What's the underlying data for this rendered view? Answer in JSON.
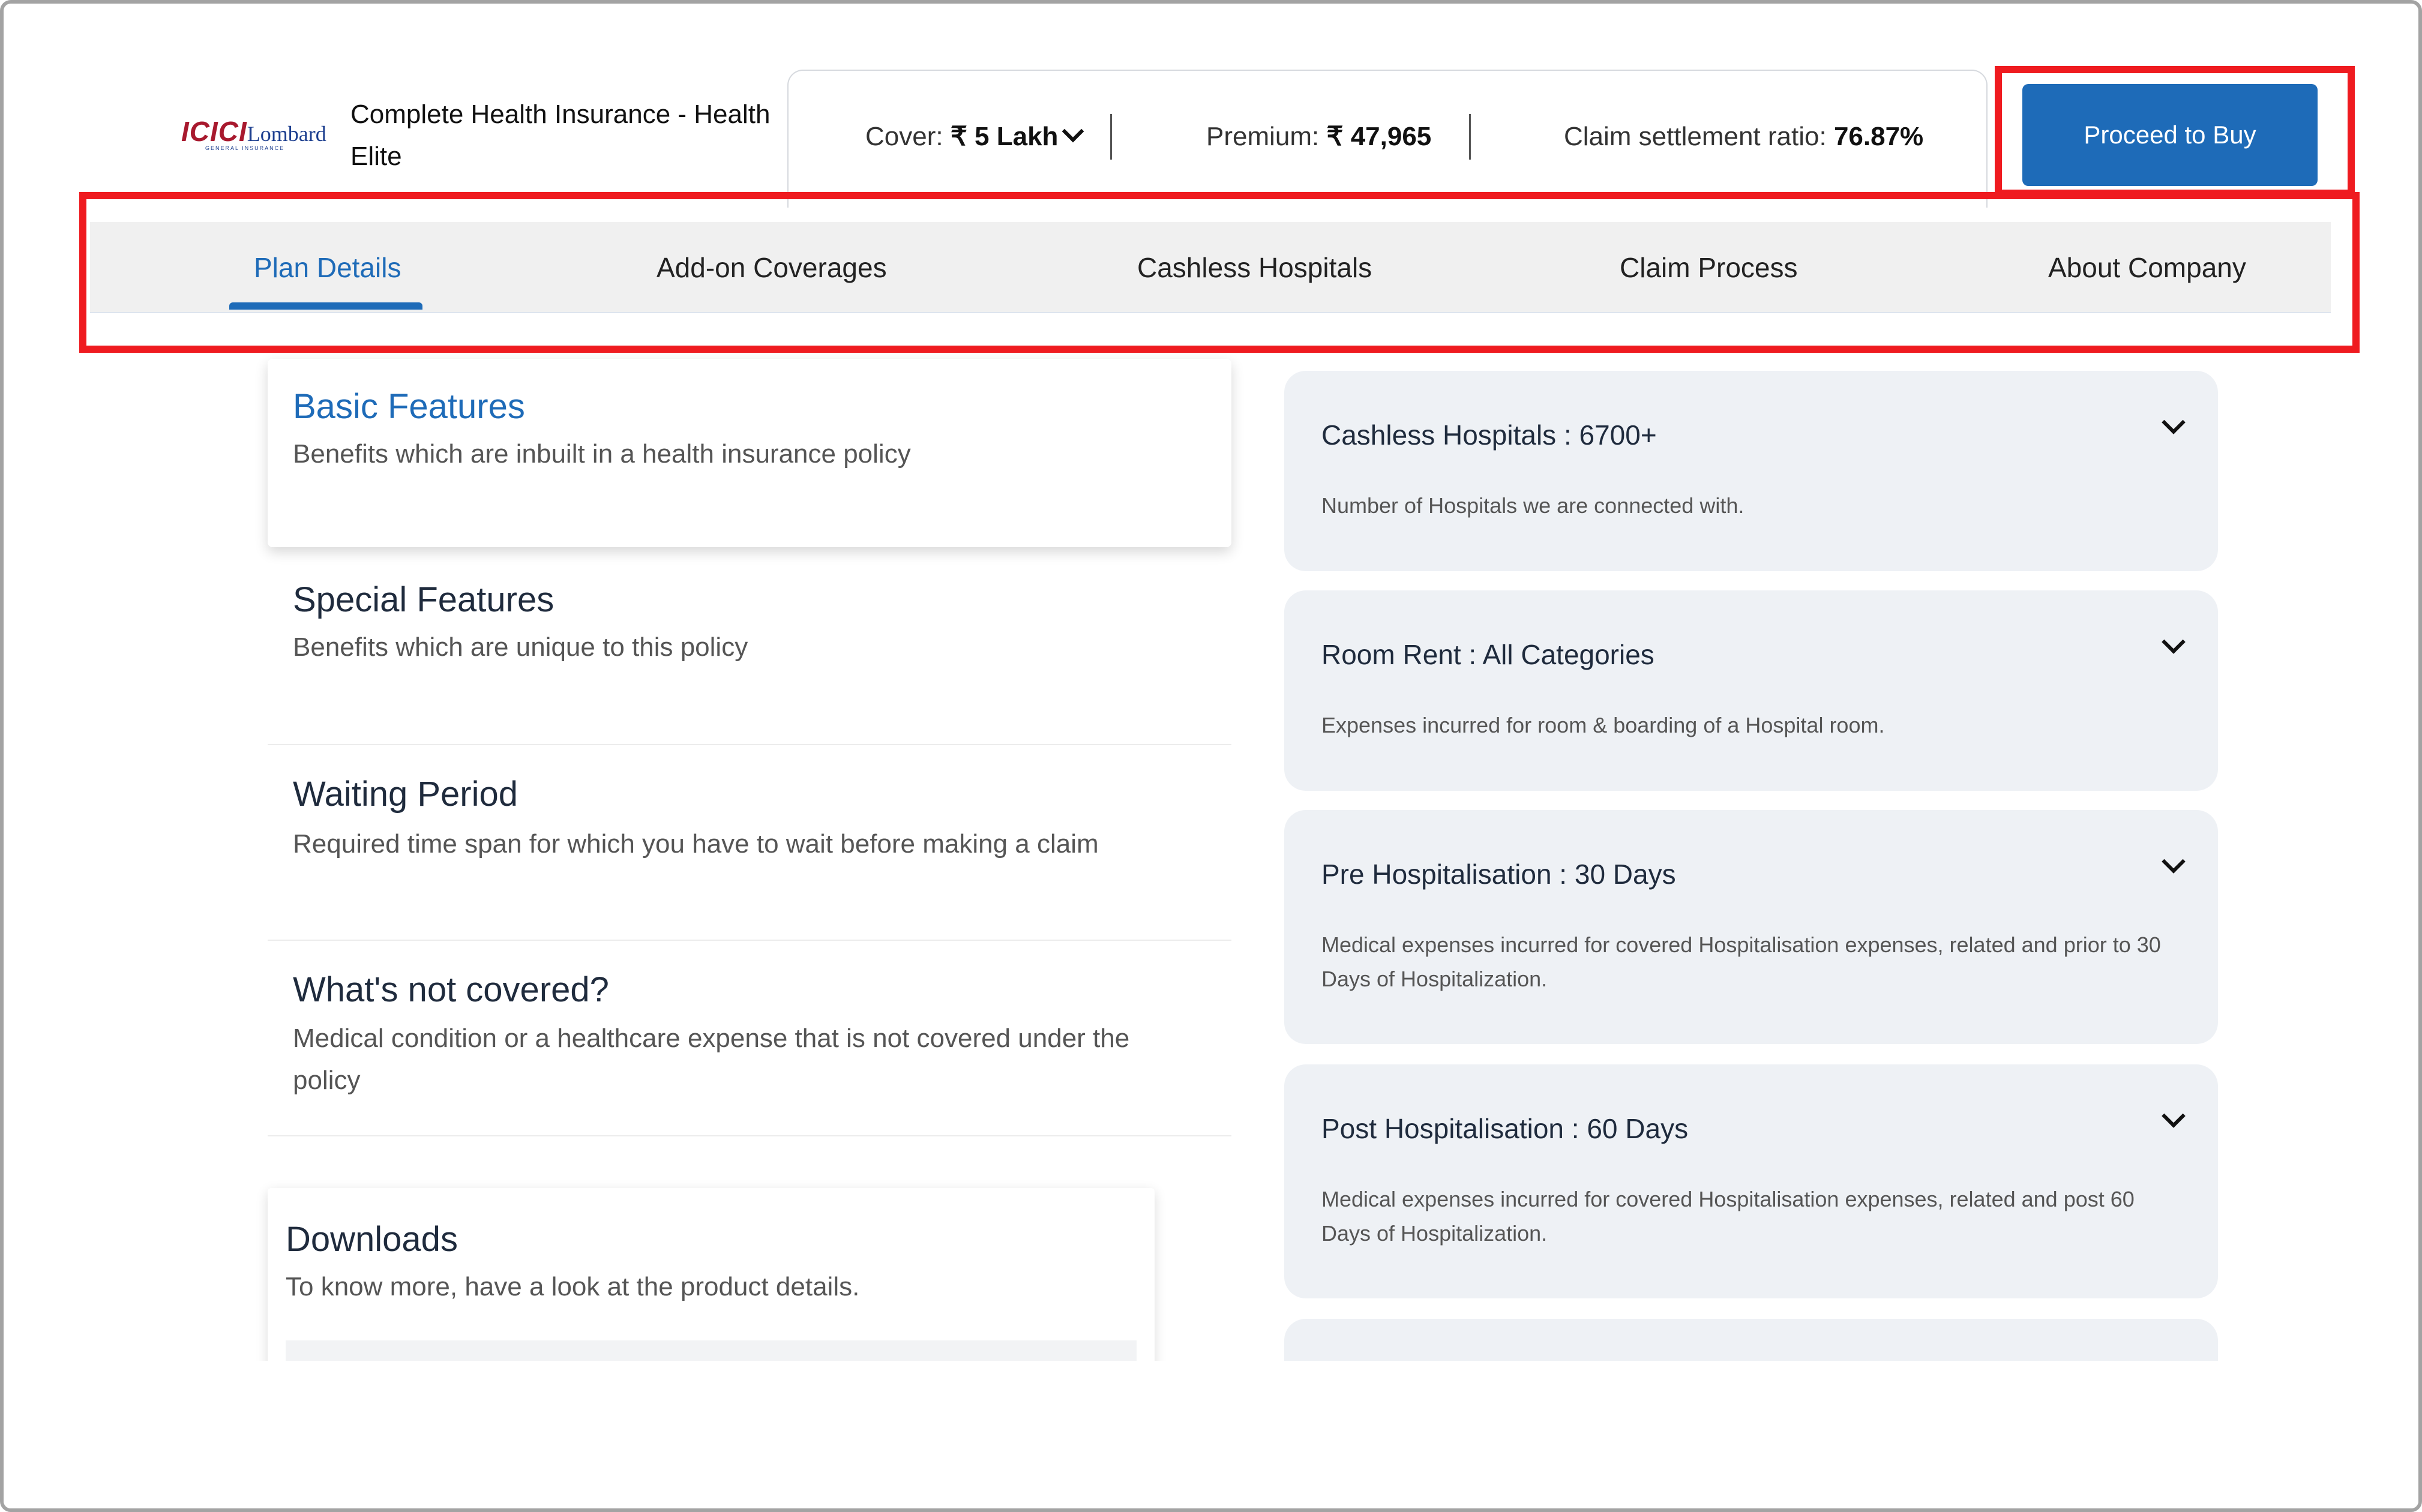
{
  "header": {
    "logo_text": "ICICI",
    "logo_text_2": "Lombard",
    "logo_subtext": "GENERAL INSURANCE",
    "plan_name": "Complete Health Insurance - Health Elite",
    "proceed_label": "Proceed to Buy"
  },
  "summary": {
    "cover_label": "Cover:",
    "cover_value": "₹ 5 Lakh",
    "premium_label": "Premium:",
    "premium_value": "₹ 47,965",
    "claim_label": "Claim settlement ratio:",
    "claim_value": "76.87%"
  },
  "tabs": [
    {
      "label": "Plan Details",
      "active": true
    },
    {
      "label": "Add-on Coverages",
      "active": false
    },
    {
      "label": "Cashless Hospitals",
      "active": false
    },
    {
      "label": "Claim Process",
      "active": false
    },
    {
      "label": "About Company",
      "active": false
    }
  ],
  "features": [
    {
      "title": "Basic Features",
      "desc": "Benefits which are inbuilt in a health insurance policy",
      "active": true
    },
    {
      "title": "Special Features",
      "desc": "Benefits which are unique to this policy",
      "active": false
    },
    {
      "title": "Waiting Period",
      "desc": "Required time span for which you have to wait before making a claim",
      "active": false
    },
    {
      "title": "What's not covered?",
      "desc": "Medical condition or a healthcare expense that is not covered under the policy",
      "active": false
    }
  ],
  "downloads": {
    "title": "Downloads",
    "desc": "To know more, have a look at the product details."
  },
  "cards": [
    {
      "title": "Cashless Hospitals : 6700+",
      "desc": "Number of Hospitals we are connected with."
    },
    {
      "title": "Room Rent : All Categories",
      "desc": "Expenses incurred for room & boarding of a Hospital room."
    },
    {
      "title": "Pre Hospitalisation : 30 Days",
      "desc": "Medical expenses incurred for covered Hospitalisation expenses, related and prior to 30 Days of Hospitalization."
    },
    {
      "title": "Post Hospitalisation : 60 Days",
      "desc": "Medical expenses incurred for covered Hospitalisation expenses, related and post 60 Days of Hospitalization."
    }
  ],
  "colors": {
    "accent": "#1e6bb8",
    "highlight": "#ef1b20",
    "card_bg": "#eef1f5",
    "tab_bar_bg": "#f0f0f0"
  },
  "icons": {
    "dropdown": "chevron-down-icon",
    "card_toggle": "chevron-down-icon"
  }
}
